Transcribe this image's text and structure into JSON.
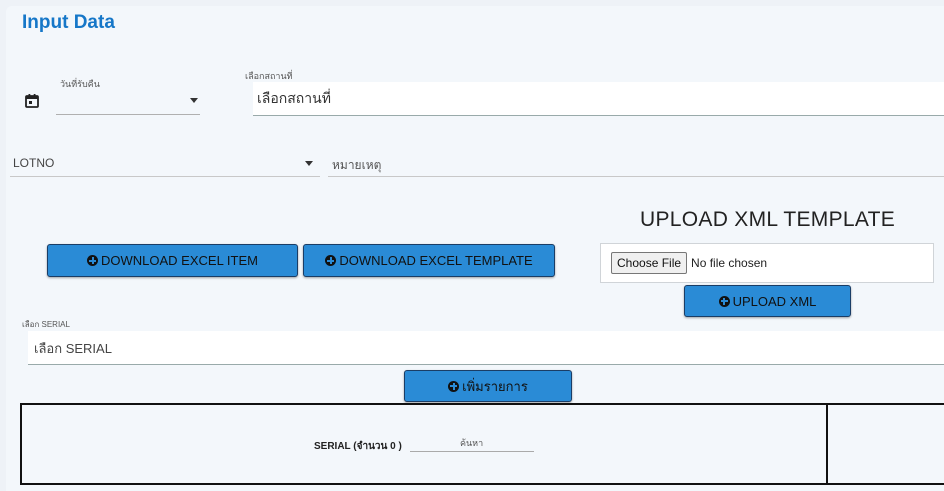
{
  "page": {
    "title": "Input Data"
  },
  "date": {
    "label": "วันที่รับคืน",
    "value": ""
  },
  "location": {
    "label": "เลือกสถานที่",
    "value": "เลือกสถานที่"
  },
  "lotno": {
    "label": "LOTNO"
  },
  "remark": {
    "placeholder": "หมายเหตุ"
  },
  "buttons": {
    "download_item": "DOWNLOAD EXCEL ITEM",
    "download_template": "DOWNLOAD EXCEL TEMPLATE",
    "upload_xml": "UPLOAD XML",
    "add_item": "เพิ่มรายการ"
  },
  "upload": {
    "title": "UPLOAD XML TEMPLATE",
    "choose_file": "Choose File",
    "file_status": "No file chosen"
  },
  "serial": {
    "label": "เลือก SERIAL",
    "value": "เลือก SERIAL"
  },
  "table": {
    "serial_count": "SERIAL (จำนวน 0 )",
    "search_placeholder": "ค้นหา"
  },
  "icons": {
    "date": "calendar-icon",
    "add": "plus-circle-icon",
    "dropdown": "caret-down-icon"
  },
  "colors": {
    "accent": "#2a8bd6",
    "title": "#1677c8"
  }
}
